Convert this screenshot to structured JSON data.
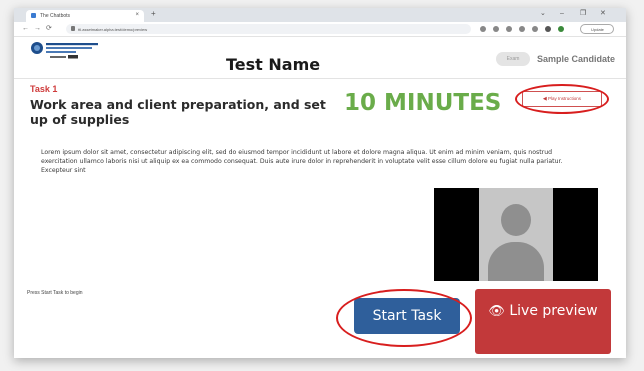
{
  "browser": {
    "tab_title": "The Chatbots",
    "tab_close_icon": "×",
    "new_tab_icon": "+",
    "window_controls": [
      "⌄",
      "–",
      "❐",
      "✕"
    ],
    "nav_icons": [
      "←",
      "→",
      "⟳"
    ],
    "url": "ttl.assetmaker.alpha.test/demo/preview",
    "update_label": "Update"
  },
  "header": {
    "title": "Test Name",
    "avatar_text": "Exam",
    "candidate_name": "Sample Candidate"
  },
  "task": {
    "number": "Task 1",
    "title": "Work area and client preparation, and set up of supplies",
    "duration": "10 MINUTES",
    "play_instructions_icon": "◀",
    "play_instructions_label": "Play Instructions",
    "description": "Lorem ipsum dolor sit amet, consectetur adipiscing elit, sed do eiusmod tempor incididunt ut labore et dolore magna aliqua. Ut enim ad minim veniam, quis nostrud exercitation ullamco laboris nisi ut aliquip ex ea commodo consequat. Duis aute irure dolor in reprehenderit in voluptate velit esse cillum dolore eu fugiat nulla pariatur. Excepteur sint"
  },
  "footer": {
    "hint": "Press Start Task to begin",
    "start_label": "Start Task",
    "live_icon": "👁",
    "live_label": "Live preview"
  },
  "colors": {
    "minutes_green": "#6aac4a",
    "task_red": "#cf3b3b",
    "start_blue": "#2f5f9b",
    "live_red": "#c2393a",
    "annotation_ring": "#d81e1e"
  }
}
